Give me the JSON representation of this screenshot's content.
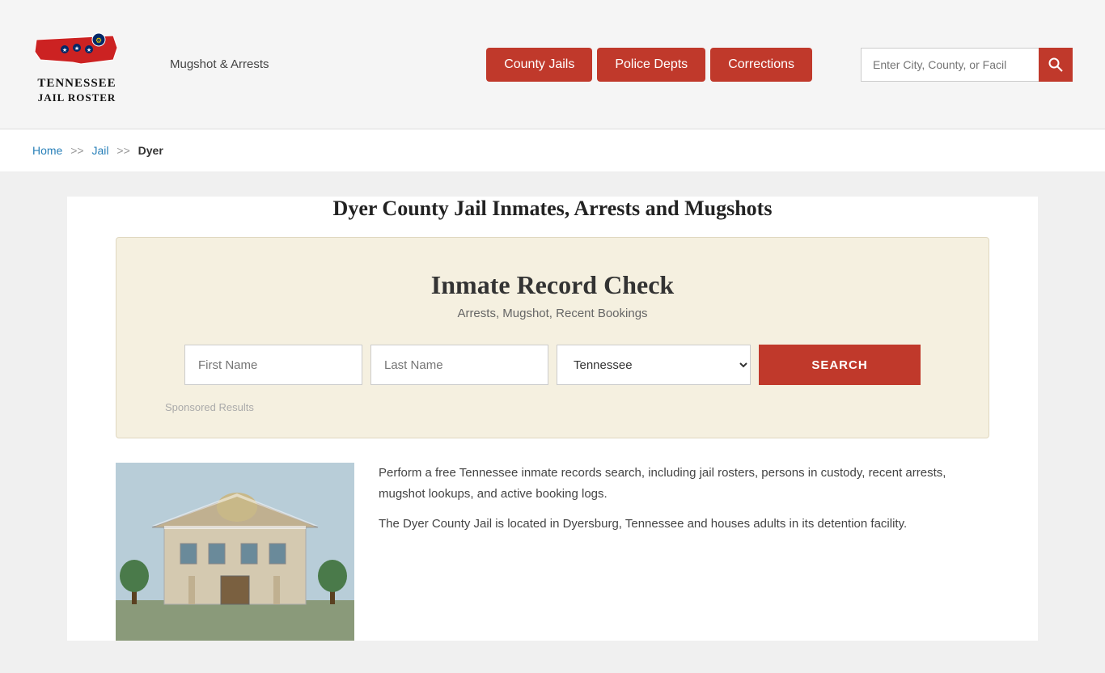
{
  "header": {
    "logo": {
      "line1": "TENNESSEE",
      "line2": "JAIL ROSTER"
    },
    "mugshot_link": "Mugshot & Arrests",
    "nav": [
      {
        "id": "county-jails",
        "label": "County Jails"
      },
      {
        "id": "police-depts",
        "label": "Police Depts"
      },
      {
        "id": "corrections",
        "label": "Corrections"
      }
    ],
    "search_placeholder": "Enter City, County, or Facil"
  },
  "breadcrumb": {
    "home": "Home",
    "sep1": ">>",
    "jail": "Jail",
    "sep2": ">>",
    "current": "Dyer"
  },
  "page": {
    "title": "Dyer County Jail Inmates, Arrests and Mugshots"
  },
  "record_check": {
    "title": "Inmate Record Check",
    "subtitle": "Arrests, Mugshot, Recent Bookings",
    "first_name_placeholder": "First Name",
    "last_name_placeholder": "Last Name",
    "state_default": "Tennessee",
    "search_label": "SEARCH",
    "sponsored": "Sponsored Results"
  },
  "description": {
    "para1": "Perform a free Tennessee inmate records search, including jail rosters, persons in custody, recent arrests, mugshot lookups, and active booking logs.",
    "para2": "The Dyer County Jail is located in Dyersburg, Tennessee and houses adults in its detention facility."
  }
}
